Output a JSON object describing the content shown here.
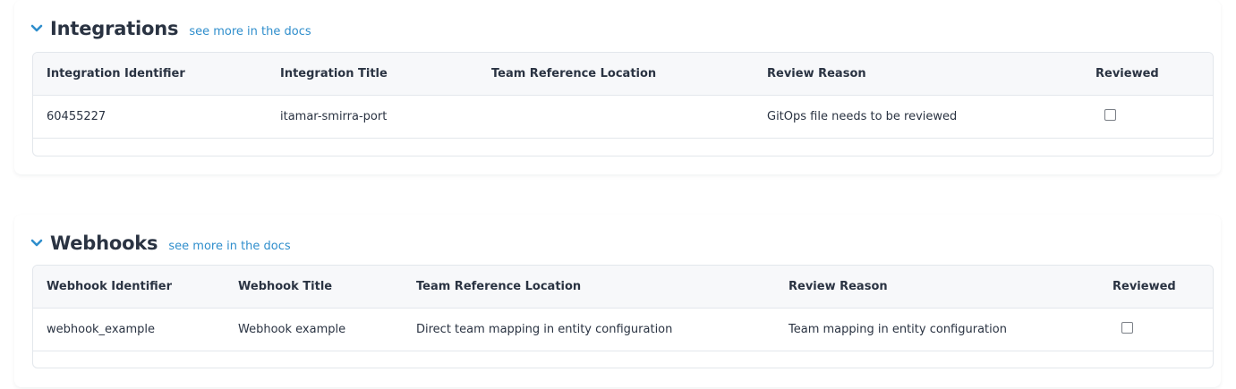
{
  "integrations": {
    "title": "Integrations",
    "docs_link": "see more in the docs",
    "columns": [
      "Integration Identifier",
      "Integration Title",
      "Team Reference Location",
      "Review Reason",
      "Reviewed"
    ],
    "rows": [
      {
        "identifier": "60455227",
        "title": "itamar-smirra-port",
        "team_reference_location": "",
        "review_reason": "GitOps file needs to be reviewed",
        "reviewed": false
      }
    ]
  },
  "webhooks": {
    "title": "Webhooks",
    "docs_link": "see more in the docs",
    "columns": [
      "Webhook Identifier",
      "Webhook Title",
      "Team Reference Location",
      "Review Reason",
      "Reviewed"
    ],
    "rows": [
      {
        "identifier": "webhook_example",
        "title": "Webhook example",
        "team_reference_location": "Direct team mapping in entity configuration",
        "review_reason": "Team mapping in entity configuration",
        "reviewed": false
      }
    ]
  },
  "colors": {
    "accent": "#2f8ecc",
    "text": "#2a3342",
    "header_bg": "#f7f8fa",
    "border": "#e3e7ec"
  },
  "icons": {
    "collapse": "chevron-down-icon"
  }
}
